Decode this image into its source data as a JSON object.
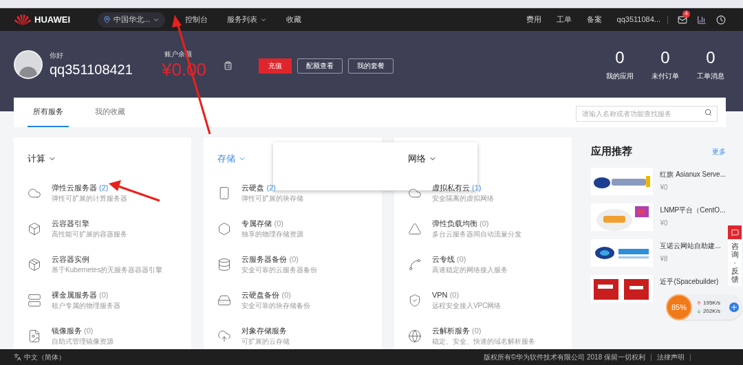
{
  "nav": {
    "brand": "HUAWEI",
    "region": "中国华北...",
    "links": [
      {
        "label": "控制台",
        "dropdown": false
      },
      {
        "label": "服务列表",
        "dropdown": true
      },
      {
        "label": "收藏",
        "dropdown": false
      }
    ],
    "right_links": [
      "费用",
      "工单",
      "备案"
    ],
    "account": "qq3511084...",
    "mail_badge": "4"
  },
  "hero": {
    "greeting": "你好",
    "username": "qq351108421",
    "balance_label": "账户余额",
    "balance": "¥0.00",
    "buttons": [
      {
        "label": "充值",
        "primary": true
      },
      {
        "label": "配额查看",
        "primary": false
      },
      {
        "label": "我的套餐",
        "primary": false
      }
    ],
    "stats": [
      {
        "value": "0",
        "label": "我的应用"
      },
      {
        "value": "0",
        "label": "未付订单"
      },
      {
        "value": "0",
        "label": "工单消息"
      }
    ]
  },
  "tabs": [
    {
      "label": "所有服务",
      "selected": true
    },
    {
      "label": "我的收藏",
      "selected": false
    }
  ],
  "search": {
    "placeholder": "请输入名称或者功能查找服务"
  },
  "sections": [
    {
      "title": "计算",
      "highlighted": false,
      "items": [
        {
          "name": "弹性云服务器",
          "count": "(2)",
          "active": true,
          "desc": "弹性可扩展的计算服务器"
        },
        {
          "name": "云容器引擎",
          "desc": "高性能可扩展的容器服务"
        },
        {
          "name": "云容器实例",
          "desc": "基于Kubernetes的无服务器容器引擎"
        },
        {
          "name": "裸金属服务器",
          "count": "(0)",
          "active": false,
          "desc": "租户专属的物理服务器"
        },
        {
          "name": "镜像服务",
          "count": "(0)",
          "active": false,
          "desc": "自助式管理镜像资源"
        }
      ]
    },
    {
      "title": "存储",
      "highlighted": true,
      "items": [
        {
          "name": "云硬盘",
          "count": "(2)",
          "active": true,
          "desc": "弹性可扩展的块存储"
        },
        {
          "name": "专属存储",
          "count": "(0)",
          "active": false,
          "desc": "独享的物理存储资源"
        },
        {
          "name": "云服务器备份",
          "count": "(0)",
          "active": false,
          "desc": "安全可靠的云服务器备份"
        },
        {
          "name": "云硬盘备份",
          "count": "(0)",
          "active": false,
          "desc": "安全可靠的块存储备份"
        },
        {
          "name": "对象存储服务",
          "desc": "可扩展的云存储"
        }
      ]
    },
    {
      "title": "网络",
      "highlighted": false,
      "items": [
        {
          "name": "虚拟私有云",
          "count": "(1)",
          "active": true,
          "desc": "安全隔离的虚拟网络"
        },
        {
          "name": "弹性负载均衡",
          "count": "(0)",
          "active": false,
          "desc": "多台云服务器间自动流量分发"
        },
        {
          "name": "云专线",
          "count": "(0)",
          "active": false,
          "desc": "高速稳定的网络接入服务"
        },
        {
          "name": "VPN",
          "count": "(0)",
          "active": false,
          "desc": "远程安全接入VPC网络"
        },
        {
          "name": "云解析服务",
          "count": "(0)",
          "active": false,
          "desc": "稳定、安全、快速的域名解析服务"
        }
      ]
    }
  ],
  "apps": {
    "title": "应用推荐",
    "more": "更多",
    "items": [
      {
        "name": "红旗 Asianux Serve...",
        "price": "¥0"
      },
      {
        "name": "LNMP平台（CentO...",
        "price": "¥0"
      },
      {
        "name": "互诺云网站自助建...",
        "price": "¥8"
      },
      {
        "name": "近乎(Spacebuilder)"
      }
    ]
  },
  "feedback": {
    "label": "咨询·反馈"
  },
  "speed_ball": {
    "percent": "85%",
    "upload": "195K/s",
    "download": "202K/s"
  },
  "footer": {
    "language": "中文（简体）",
    "copyright": "版权所有©华为软件技术有限公司 2018 保留一切权利",
    "links": [
      "法律声明"
    ]
  }
}
